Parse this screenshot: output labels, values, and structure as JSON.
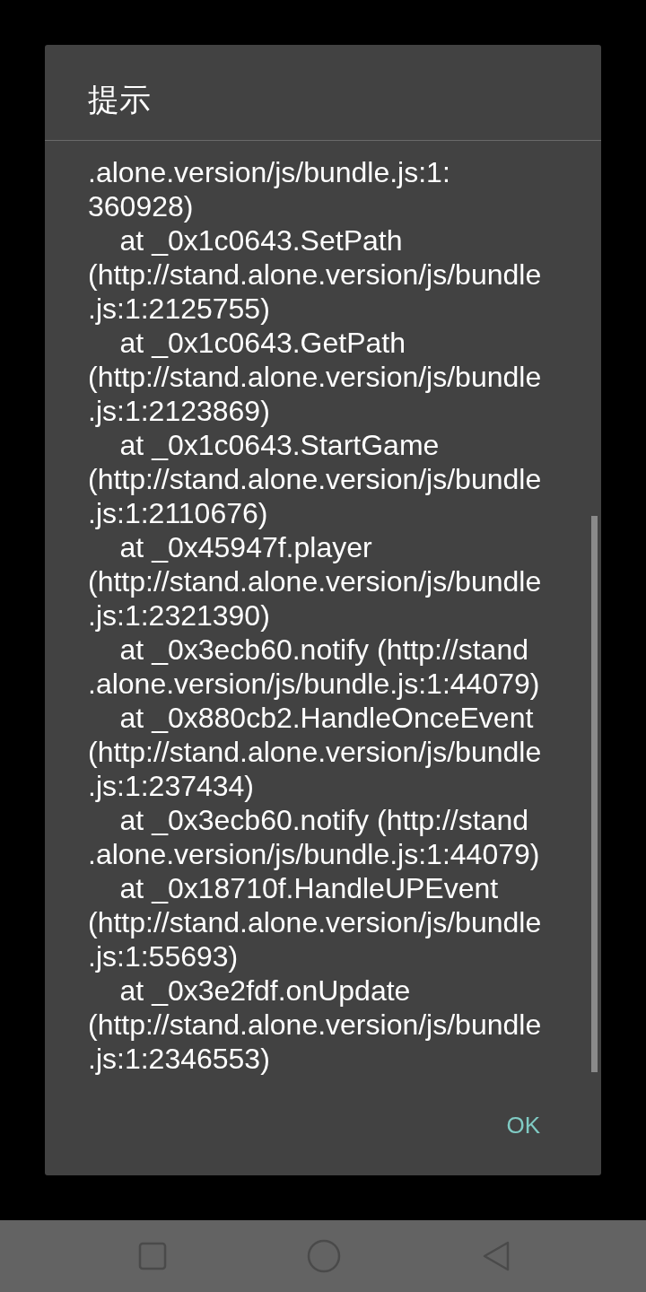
{
  "dialog": {
    "title": "提示",
    "message_lines": [
      ".alone.version/js/bundle.js:1:",
      "360928)",
      "    at _0x1c0643.SetPath",
      "(http://stand.alone.version/js/bundle",
      ".js:1:2125755)",
      "    at _0x1c0643.GetPath",
      "(http://stand.alone.version/js/bundle",
      ".js:1:2123869)",
      "    at _0x1c0643.StartGame",
      "(http://stand.alone.version/js/bundle",
      ".js:1:2110676)",
      "    at _0x45947f.player",
      "(http://stand.alone.version/js/bundle",
      ".js:1:2321390)",
      "    at _0x3ecb60.notify (http://stand",
      ".alone.version/js/bundle.js:1:44079)",
      "    at _0x880cb2.HandleOnceEvent",
      "(http://stand.alone.version/js/bundle",
      ".js:1:237434)",
      "    at _0x3ecb60.notify (http://stand",
      ".alone.version/js/bundle.js:1:44079)",
      "    at _0x18710f.HandleUPEvent",
      "(http://stand.alone.version/js/bundle",
      ".js:1:55693)",
      "    at _0x3e2fdf.onUpdate",
      "(http://stand.alone.version/js/bundle",
      ".js:1:2346553)"
    ],
    "buttons": [
      "OK"
    ]
  }
}
